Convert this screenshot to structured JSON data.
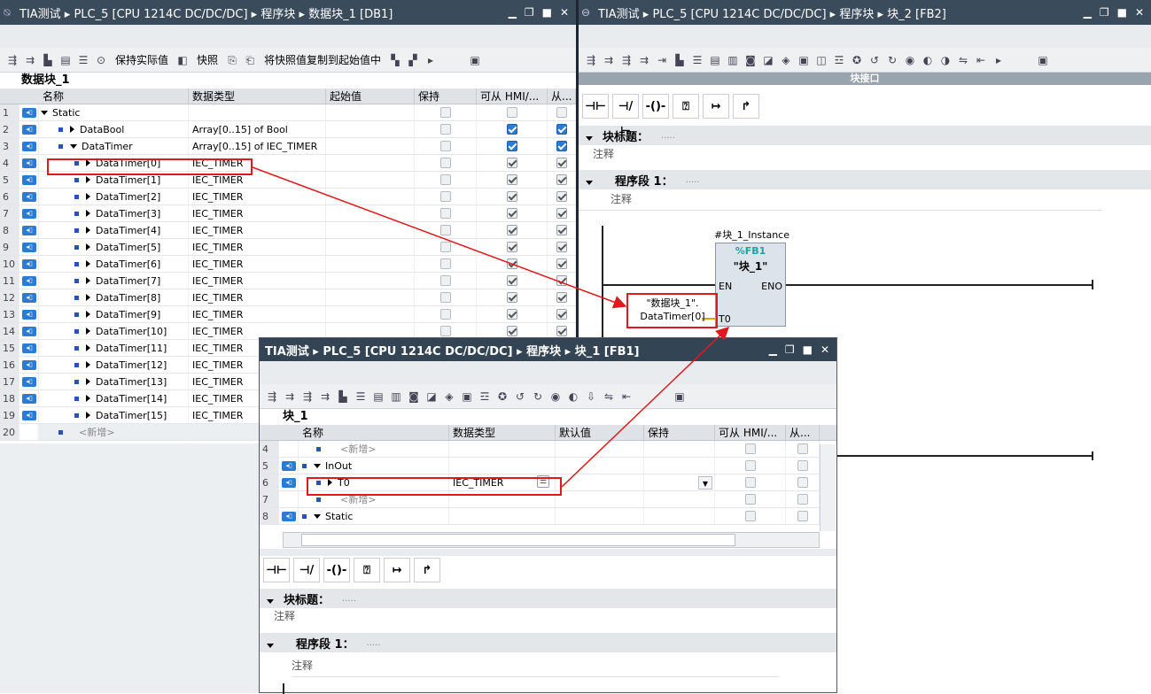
{
  "left": {
    "title": "TIA测试 ▸ PLC_5 [CPU 1214C DC/DC/DC] ▸ 程序块 ▸ 数据块_1 [DB1]",
    "keep_actual": "保持实际值",
    "snapshot": "快照",
    "copy_snapshot": "将快照值复制到起始值中",
    "db_name": "数据块_1",
    "columns": [
      "名称",
      "数据类型",
      "起始值",
      "保持",
      "可从 HMI/...",
      "从..."
    ],
    "rows": [
      {
        "n": "1",
        "name": "Static",
        "type": ""
      },
      {
        "n": "2",
        "name": "DataBool",
        "type": "Array[0..15] of Bool"
      },
      {
        "n": "3",
        "name": "DataTimer",
        "type": "Array[0..15] of IEC_TIMER"
      },
      {
        "n": "4",
        "name": "DataTimer[0]",
        "type": "IEC_TIMER"
      },
      {
        "n": "5",
        "name": "DataTimer[1]",
        "type": "IEC_TIMER"
      },
      {
        "n": "6",
        "name": "DataTimer[2]",
        "type": "IEC_TIMER"
      },
      {
        "n": "7",
        "name": "DataTimer[3]",
        "type": "IEC_TIMER"
      },
      {
        "n": "8",
        "name": "DataTimer[4]",
        "type": "IEC_TIMER"
      },
      {
        "n": "9",
        "name": "DataTimer[5]",
        "type": "IEC_TIMER"
      },
      {
        "n": "10",
        "name": "DataTimer[6]",
        "type": "IEC_TIMER"
      },
      {
        "n": "11",
        "name": "DataTimer[7]",
        "type": "IEC_TIMER"
      },
      {
        "n": "12",
        "name": "DataTimer[8]",
        "type": "IEC_TIMER"
      },
      {
        "n": "13",
        "name": "DataTimer[9]",
        "type": "IEC_TIMER"
      },
      {
        "n": "14",
        "name": "DataTimer[10]",
        "type": "IEC_TIMER"
      },
      {
        "n": "15",
        "name": "DataTimer[11]",
        "type": "IEC_TIMER"
      },
      {
        "n": "16",
        "name": "DataTimer[12]",
        "type": "IEC_TIMER"
      },
      {
        "n": "17",
        "name": "DataTimer[13]",
        "type": "IEC_TIMER"
      },
      {
        "n": "18",
        "name": "DataTimer[14]",
        "type": "IEC_TIMER"
      },
      {
        "n": "19",
        "name": "DataTimer[15]",
        "type": "IEC_TIMER"
      },
      {
        "n": "20",
        "name": "<新增>",
        "type": ""
      }
    ]
  },
  "right": {
    "title": "TIA测试 ▸ PLC_5 [CPU 1214C DC/DC/DC] ▸ 程序块 ▸ 块_2 [FB2]",
    "interface": "块接口",
    "block_title": "块标题：",
    "block_title_val": ".....",
    "comment": "注释",
    "network": "程序段 1：",
    "network_val": ".....",
    "network_comment": "注释",
    "instance": "#块_1_Instance",
    "fb_num": "%FB1",
    "fb_name": "\"块_1\"",
    "en": "EN",
    "eno": "ENO",
    "t0": "T0",
    "param1": "\"数据块_1\".",
    "param2": "DataTimer[0]"
  },
  "float": {
    "title": "TIA测试 ▸ PLC_5 [CPU 1214C DC/DC/DC] ▸ 程序块 ▸ 块_1 [FB1]",
    "block": "块_1",
    "columns": [
      "名称",
      "数据类型",
      "默认值",
      "保持",
      "可从 HMI/...",
      "从..."
    ],
    "rows": [
      {
        "n": "4",
        "name": "<新增>",
        "type": ""
      },
      {
        "n": "5",
        "name": "InOut",
        "type": ""
      },
      {
        "n": "6",
        "name": "T0",
        "type": "IEC_TIMER"
      },
      {
        "n": "7",
        "name": "<新增>",
        "type": ""
      },
      {
        "n": "8",
        "name": "Static",
        "type": ""
      }
    ],
    "block_title": "块标题：",
    "block_title_val": ".....",
    "comment": "注释",
    "network": "程序段 1：",
    "network_val": ".....",
    "network_comment": "注释"
  }
}
